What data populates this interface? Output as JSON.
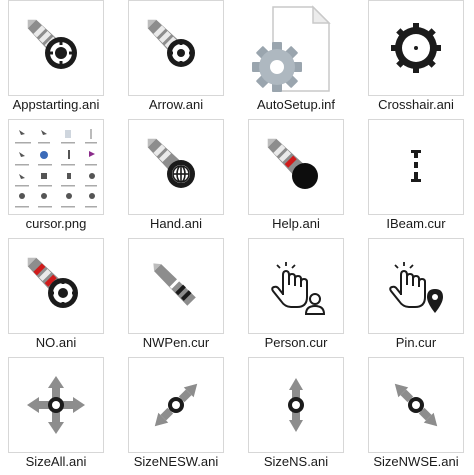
{
  "files": [
    {
      "name": "Appstarting.ani",
      "icon": "appstarting-cursor-icon"
    },
    {
      "name": "Arrow.ani",
      "icon": "arrow-cursor-icon"
    },
    {
      "name": "AutoSetup.inf",
      "icon": "inf-file-gear-icon"
    },
    {
      "name": "Crosshair.ani",
      "icon": "crosshair-cursor-icon"
    },
    {
      "name": "cursor.png",
      "icon": "image-preview-thumbnail"
    },
    {
      "name": "Hand.ani",
      "icon": "hand-cursor-icon"
    },
    {
      "name": "Help.ani",
      "icon": "help-cursor-icon"
    },
    {
      "name": "IBeam.cur",
      "icon": "ibeam-cursor-icon"
    },
    {
      "name": "NO.ani",
      "icon": "no-cursor-icon"
    },
    {
      "name": "NWPen.cur",
      "icon": "pen-cursor-icon"
    },
    {
      "name": "Person.cur",
      "icon": "person-cursor-icon"
    },
    {
      "name": "Pin.cur",
      "icon": "pin-cursor-icon"
    },
    {
      "name": "SizeAll.ani",
      "icon": "size-all-cursor-icon"
    },
    {
      "name": "SizeNESW.ani",
      "icon": "size-nesw-cursor-icon"
    },
    {
      "name": "SizeNS.ani",
      "icon": "size-ns-cursor-icon"
    },
    {
      "name": "SizeNWSE.ani",
      "icon": "size-nwse-cursor-icon"
    }
  ],
  "colors": {
    "border": "#d7d7d7",
    "text": "#1a1a1a",
    "accent_red": "#d01b1b"
  }
}
